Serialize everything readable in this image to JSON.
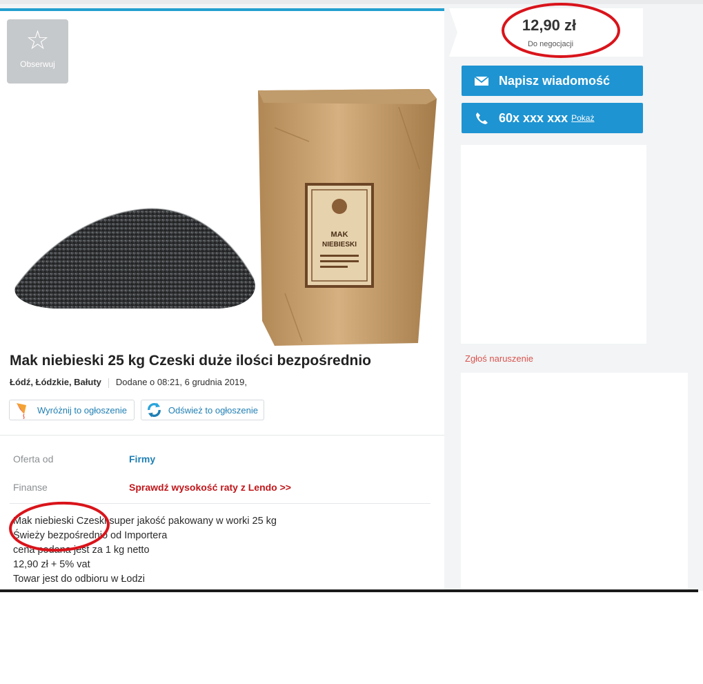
{
  "observe": {
    "icon": "star-outline-icon",
    "label": "Obserwuj"
  },
  "ad": {
    "title": "Mak niebieski 25 kg Czeski duże ilości bezpośrednio",
    "location": "Łódź, Łódzkie, Bałuty",
    "added": "Dodane o 08:21, 6 grudnia 2019,",
    "bag_label": {
      "line1": "MAK",
      "line2": "NIEBIESKI"
    }
  },
  "actions": {
    "highlight": "Wyróżnij to ogłoszenie",
    "refresh": "Odśwież to ogłoszenie"
  },
  "details": [
    {
      "key": "Oferta od",
      "value": "Firmy",
      "color": "#1f7fb4"
    },
    {
      "key": "Finanse",
      "value": "Sprawdź wysokość raty z Lendo >>",
      "color": "#c0161a"
    }
  ],
  "description": [
    "Mak niebieski Czeski super jakość pakowany w worki 25 kg",
    "Świeży bezpośrednio od Importera",
    "cena podana jest za 1 kg netto",
    "12,90 zł + 5% vat",
    "Towar jest do odbioru w Łodzi"
  ],
  "sidebar": {
    "price": "12,90 zł",
    "negotiable": "Do negocjacji",
    "message_button": "Napisz wiadomość",
    "phone_number": "60x xxx xxx",
    "phone_show": "Pokaż",
    "report_link": "Zgłoś naruszenie"
  },
  "colors": {
    "accent": "#1e94d2",
    "annotation": "#d9141b",
    "link": "#1f7fb4",
    "report": "#d9534f"
  }
}
